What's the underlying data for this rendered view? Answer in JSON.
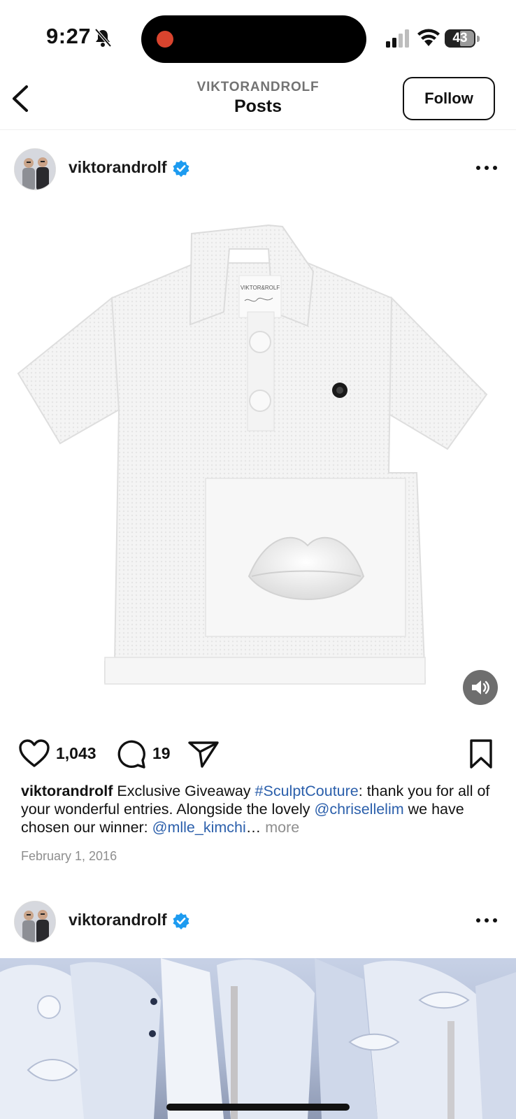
{
  "status_bar": {
    "time": "9:27",
    "battery_level": "43"
  },
  "nav": {
    "subtitle": "VIKTORANDROLF",
    "title": "Posts",
    "follow_label": "Follow"
  },
  "post1": {
    "username": "viktorandrolf",
    "likes": "1,043",
    "comments": "19",
    "caption": {
      "username": "viktorandrolf",
      "text1": " Exclusive Giveaway ",
      "hashtag": "#SculptCouture",
      "text2": ": thank you for all of your wonderful entries. Alongside the lovely ",
      "mention1": "@chrisellelim",
      "text3": " we have chosen our winner: ",
      "mention2": "@mlle_kimchi",
      "ellipsis": "…",
      "more": " more"
    },
    "date": "February 1, 2016",
    "image_tag_text": "VIKTOR&ROLF"
  },
  "post2": {
    "username": "viktorandrolf"
  },
  "colors": {
    "verified_blue": "#1d9bf0",
    "link_blue": "#2b5fab",
    "muted_gray": "#8e8e8e",
    "recording_red": "#d9442e"
  },
  "icons": [
    "bell-slash-icon",
    "signal-icon",
    "wifi-icon",
    "battery-icon",
    "back-chevron-icon",
    "verified-badge-icon",
    "more-options-icon",
    "sound-icon",
    "heart-icon",
    "comment-icon",
    "share-icon",
    "bookmark-icon"
  ]
}
